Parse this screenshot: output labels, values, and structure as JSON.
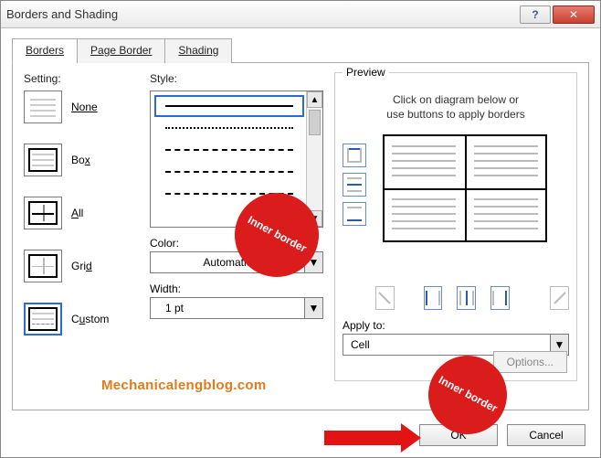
{
  "title": "Borders and Shading",
  "tabs": {
    "borders": "Borders",
    "page_border": "Page Border",
    "shading": "Shading"
  },
  "setting": {
    "heading": "Setting:",
    "none": "None",
    "box": "Box",
    "all": "All",
    "grid": "Grid",
    "custom": "Custom"
  },
  "style": {
    "heading": "Style:",
    "color_label": "Color:",
    "color_value": "Automatic",
    "width_label": "Width:",
    "width_value": "1 pt"
  },
  "preview": {
    "legend": "Preview",
    "hint_line1": "Click on diagram below or",
    "hint_line2": "use buttons to apply borders",
    "apply_label": "Apply to:",
    "apply_value": "Cell",
    "options": "Options..."
  },
  "buttons": {
    "ok": "OK",
    "cancel": "Cancel",
    "help": "?",
    "close": "✕"
  },
  "annotations": {
    "bubble1": "Inner border",
    "bubble2": "Inner border",
    "watermark": "Mechanicalengblog.com"
  }
}
